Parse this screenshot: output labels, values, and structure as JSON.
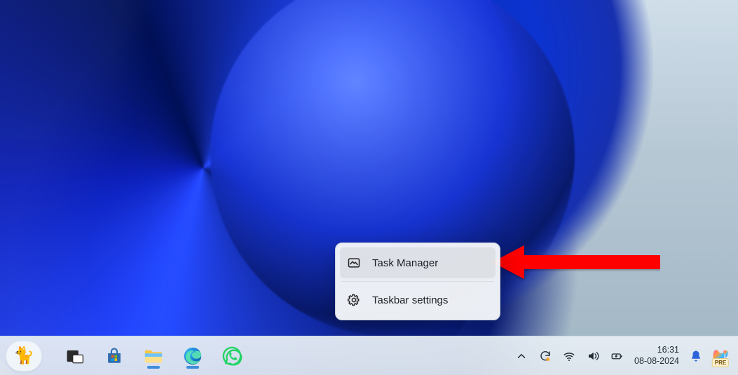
{
  "context_menu": {
    "items": [
      {
        "icon": "task-manager",
        "label": "Task Manager"
      },
      {
        "icon": "settings",
        "label": "Taskbar settings"
      }
    ],
    "highlight_index": 0
  },
  "taskbar": {
    "weather_widget_icon": "cat",
    "pinned": [
      {
        "icon": "task-view",
        "name": "task-view-button",
        "running": false
      },
      {
        "icon": "ms-store",
        "name": "microsoft-store-button",
        "running": false
      },
      {
        "icon": "file-explorer",
        "name": "file-explorer-button",
        "running": true
      },
      {
        "icon": "edge",
        "name": "edge-button",
        "running": true
      },
      {
        "icon": "whatsapp",
        "name": "whatsapp-button",
        "running": false
      }
    ]
  },
  "tray": {
    "items": [
      {
        "icon": "chevron-up",
        "name": "show-hidden-icons"
      },
      {
        "icon": "sync",
        "name": "onedrive-sync-icon"
      },
      {
        "icon": "wifi",
        "name": "wifi-icon"
      },
      {
        "icon": "volume",
        "name": "volume-icon"
      },
      {
        "icon": "battery",
        "name": "battery-icon"
      }
    ],
    "time": "16:31",
    "date": "08-08-2024",
    "notification_icon": "bell",
    "copilot_label": "PRE"
  },
  "annotation": {
    "arrow_color": "#ff0000",
    "points_to": "context_menu.items.0"
  }
}
